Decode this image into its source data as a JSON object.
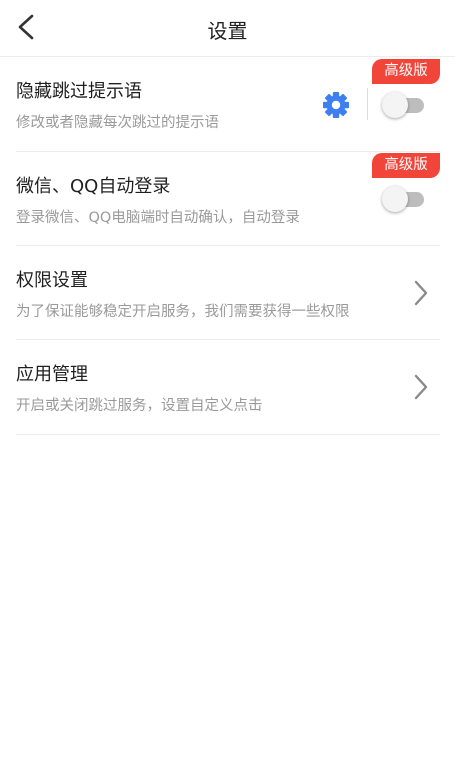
{
  "header": {
    "title": "设置"
  },
  "rows": [
    {
      "title": "隐藏跳过提示语",
      "subtitle": "修改或者隐藏每次跳过的提示语",
      "badge": "高级版",
      "toggle_on": false,
      "has_gear": true
    },
    {
      "title": "微信、QQ自动登录",
      "subtitle": "登录微信、QQ电脑端时自动确认，自动登录",
      "badge": "高级版",
      "toggle_on": false
    },
    {
      "title": "权限设置",
      "subtitle": "为了保证能够稳定开启服务，我们需要获得一些权限"
    },
    {
      "title": "应用管理",
      "subtitle": "开启或关闭跳过服务，设置自定义点击"
    }
  ],
  "colors": {
    "badge_bg": "#f2453a",
    "gear": "#3d7ff0",
    "subtitle": "#9a9a9a"
  },
  "icons": {
    "back": "chevron-left-icon",
    "gear": "gear-icon",
    "chevron": "chevron-right-icon"
  }
}
